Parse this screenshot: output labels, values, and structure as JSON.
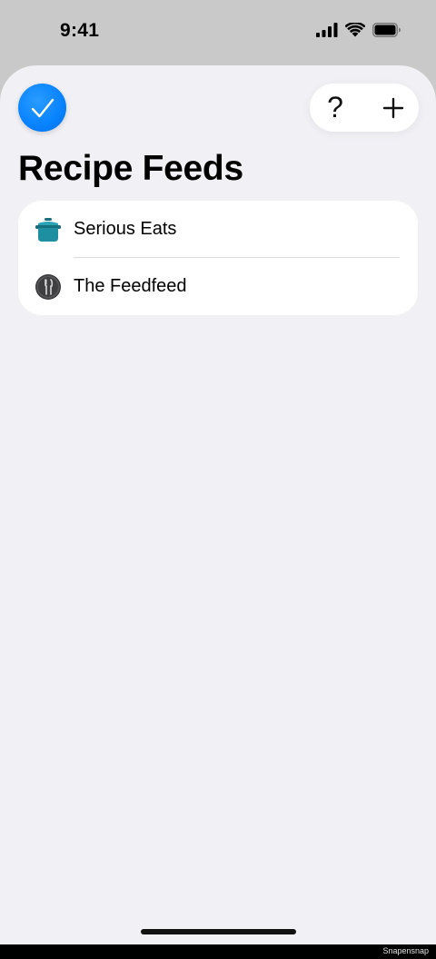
{
  "status_bar": {
    "time": "9:41",
    "icons": [
      "cellular-signal-icon",
      "wifi-icon",
      "battery-icon"
    ]
  },
  "toolbar": {
    "done_icon": "checkmark-icon",
    "help_label": "?",
    "add_icon": "plus-icon"
  },
  "page": {
    "title": "Recipe Feeds"
  },
  "feeds": [
    {
      "label": "Serious Eats",
      "icon": "cooking-pot-icon"
    },
    {
      "label": "The Feedfeed",
      "icon": "utensils-icon"
    }
  ],
  "footer": {
    "watermark": "Snapensnap"
  },
  "colors": {
    "accent": "#0a84ff",
    "background": "#f0f0f5",
    "card": "#ffffff",
    "pot": "#1d8fa0"
  }
}
